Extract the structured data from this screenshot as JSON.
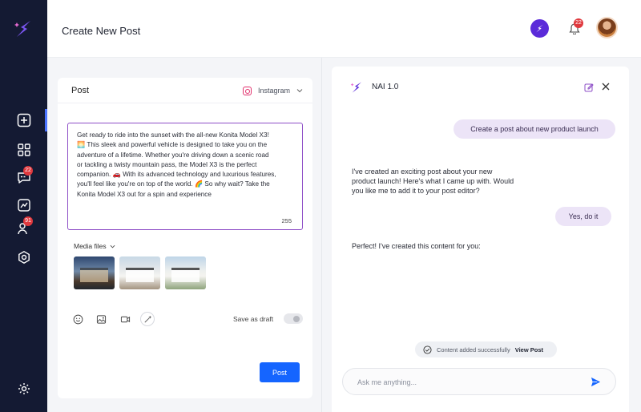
{
  "header": {
    "title": "Create New Post",
    "notification_count": "22"
  },
  "sidebar": {
    "items": [
      {
        "name": "create",
        "badge": ""
      },
      {
        "name": "dashboard",
        "badge": ""
      },
      {
        "name": "messages",
        "badge": "22"
      },
      {
        "name": "analytics",
        "badge": ""
      },
      {
        "name": "users",
        "badge": "91"
      },
      {
        "name": "integrations",
        "badge": ""
      }
    ],
    "settings": "settings"
  },
  "post": {
    "label": "Post",
    "platform": "Instagram",
    "content": "Get ready to ride into the sunset with the all-new Konita Model X3!\n🌅 This sleek and powerful vehicle is designed to take you on the\nadventure of a lifetime. Whether you're driving down a scenic road\nor tackling a twisty mountain pass, the Model X3 is the perfect\ncompanion. 🚗 With its advanced technology and luxurious features,\nyou'll feel like you're on top of the world. 🌈 So why wait? Take the\nKonita Model X3 out for a spin and experience",
    "char_count": "255",
    "media_label": "Media files",
    "save_draft_label": "Save as draft",
    "save_draft_on": false,
    "submit_label": "Post"
  },
  "assistant": {
    "title": "NAI 1.0",
    "messages": [
      {
        "role": "user",
        "text": "Create a post about new product launch"
      },
      {
        "role": "ai",
        "text": "I've created an exciting post about your new\nproduct launch! Here's what I came up with. Would\nyou like me to add it to your post editor?"
      },
      {
        "role": "user",
        "text": "Yes, do it"
      },
      {
        "role": "ai",
        "text": "Perfect! I've created this content for you:"
      }
    ],
    "toast": {
      "text": "Content added successfully",
      "link": "View Post"
    },
    "input_placeholder": "Ask me anything...",
    "input_value": ""
  },
  "colors": {
    "sidebar": "#141a33",
    "accent": "#1565ff",
    "brand": "#5b2bd9",
    "editor_border": "#8e4fc7",
    "user_bubble": "#ece4f7"
  }
}
